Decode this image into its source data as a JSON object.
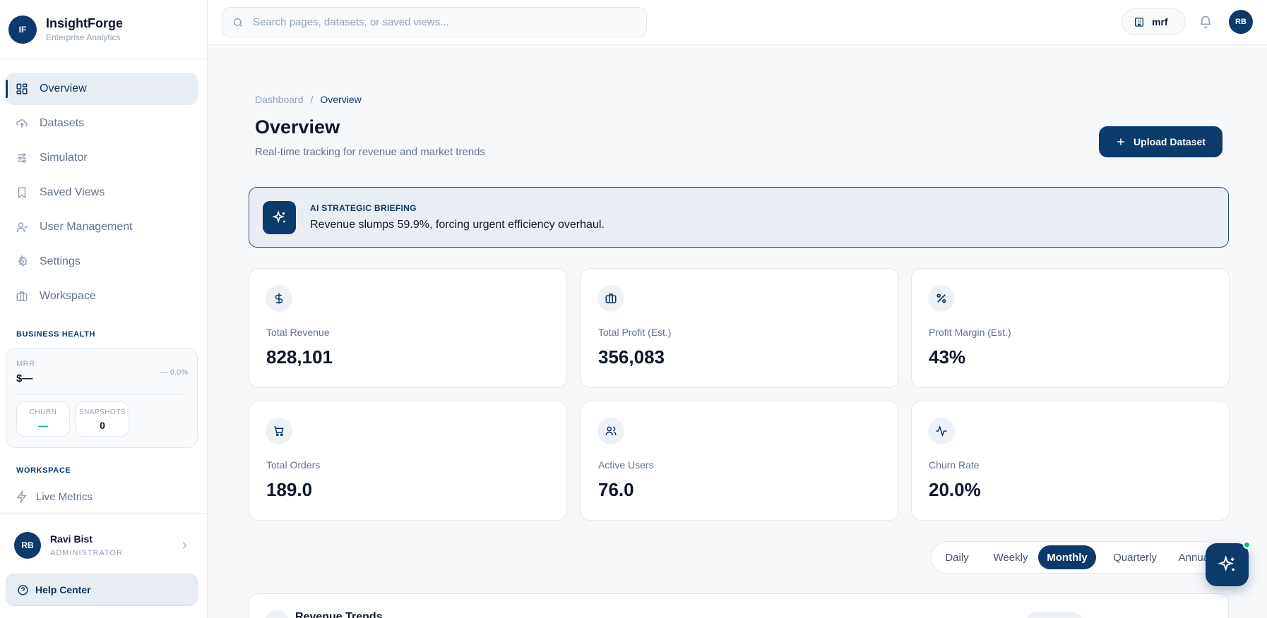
{
  "brand": {
    "logo": "IF",
    "name": "InsightForge",
    "subtitle": "Enterprise Analytics"
  },
  "sidebar": {
    "items": [
      {
        "label": "Overview",
        "icon": "grid-icon",
        "active": true
      },
      {
        "label": "Datasets",
        "icon": "cloud-upload-icon"
      },
      {
        "label": "Simulator",
        "icon": "sliders-icon"
      },
      {
        "label": "Saved Views",
        "icon": "bookmark-icon"
      },
      {
        "label": "User Management",
        "icon": "users-icon"
      },
      {
        "label": "Settings",
        "icon": "gear-icon"
      },
      {
        "label": "Workspace",
        "icon": "briefcase-icon"
      }
    ],
    "business_health": {
      "heading": "BUSINESS HEALTH",
      "mrr_label": "MRR",
      "mrr_value": "$—",
      "mrr_change": "— 0.0%",
      "churn_label": "CHURN",
      "churn_value": "—",
      "snapshots_label": "SNAPSHOTS",
      "snapshots_value": "0"
    },
    "workspace_heading": "WORKSPACE",
    "live_metrics": "Live Metrics",
    "user": {
      "initials": "RB",
      "name": "Ravi Bist",
      "role": "ADMINISTRATOR"
    },
    "help": "Help Center"
  },
  "topbar": {
    "search_placeholder": "Search pages, datasets, or saved views...",
    "workspace": "mrf",
    "avatar": "RB"
  },
  "main": {
    "breadcrumb": [
      "Dashboard",
      "/",
      "Overview"
    ],
    "title": "Overview",
    "subtitle": "Real-time tracking for revenue and market trends",
    "upload_label": "Upload Dataset",
    "briefing": {
      "label": "AI STRATEGIC BRIEFING",
      "text": "Revenue slumps 59.9%, forcing urgent efficiency overhaul."
    },
    "kpis": [
      {
        "label": "Total Revenue",
        "value": "828,101",
        "icon": "dollar-icon"
      },
      {
        "label": "Total Profit (Est.)",
        "value": "356,083",
        "icon": "briefcase-icon"
      },
      {
        "label": "Profit Margin (Est.)",
        "value": "43%",
        "icon": "percent-icon"
      },
      {
        "label": "Total Orders",
        "value": "189.0",
        "icon": "cart-icon"
      },
      {
        "label": "Active Users",
        "value": "76.0",
        "icon": "users-icon"
      },
      {
        "label": "Churn Rate",
        "value": "20.0%",
        "icon": "activity-icon"
      }
    ],
    "periods": [
      "Daily",
      "Weekly",
      "Monthly",
      "Quarterly",
      "Annual"
    ],
    "active_period": "Monthly",
    "bottom_section_title": "Revenue Trends"
  },
  "colors": {
    "brand": "#0b3a6b",
    "accent_green": "#10b981",
    "background": "#f7f8fa"
  }
}
